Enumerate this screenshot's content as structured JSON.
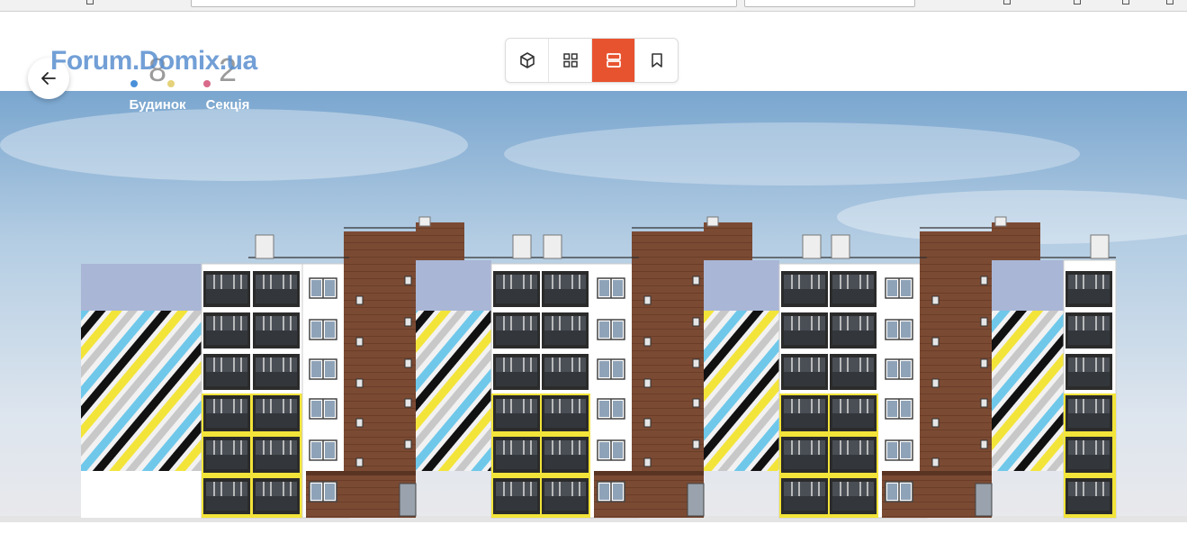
{
  "watermark": "Forum.Domix.ua",
  "counters": [
    {
      "value": "8",
      "label": "Будинок",
      "dots": [
        "#4a90d9",
        "#c9c9c9",
        "#e5d27a"
      ]
    },
    {
      "value": "2",
      "label": "Секція",
      "dots": [
        "#d96a8a"
      ]
    }
  ],
  "view_modes": [
    {
      "name": "3d-view",
      "icon": "cube-icon",
      "active": false
    },
    {
      "name": "grid-view",
      "icon": "grid-icon",
      "active": false
    },
    {
      "name": "floors-view",
      "icon": "list-rows-icon",
      "active": true
    },
    {
      "name": "saved",
      "icon": "bookmark-icon",
      "active": false
    }
  ],
  "colors": {
    "accent": "#e8532f",
    "brick": "#7b4a33",
    "stripe_blue": "#6fc8ea",
    "stripe_yellow": "#f3e43a",
    "balcony_yellow": "#f3e43a"
  },
  "building": {
    "sections": 4,
    "floors": 6
  }
}
